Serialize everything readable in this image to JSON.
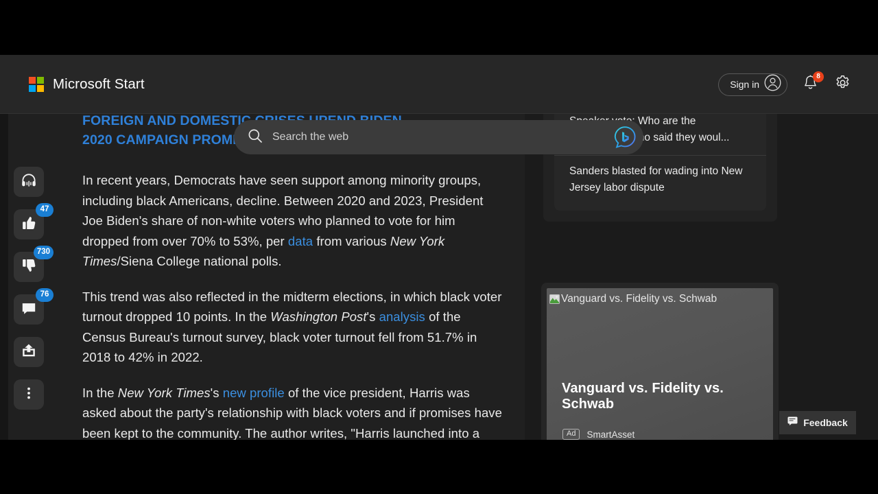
{
  "header": {
    "brand_name": "Microsoft Start",
    "logo_icon": "microsoft-logo-icon",
    "search": {
      "placeholder": "Search the web",
      "value": "",
      "search_icon": "search-icon",
      "chat_icon": "bing-chat-icon"
    },
    "sign_in_label": "Sign in",
    "account_icon": "account-person-icon",
    "notifications": {
      "icon": "bell-icon",
      "badge": "8",
      "badge_color": "#e8411a"
    },
    "settings_icon": "gear-icon"
  },
  "action_rail": [
    {
      "name": "listen",
      "icon": "headphones-icon",
      "badge": null
    },
    {
      "name": "like",
      "icon": "thumbs-up-icon",
      "badge": "47"
    },
    {
      "name": "dislike",
      "icon": "thumbs-down-icon",
      "badge": "730"
    },
    {
      "name": "comments",
      "icon": "comment-icon",
      "badge": "76"
    },
    {
      "name": "share",
      "icon": "share-icon",
      "badge": null
    },
    {
      "name": "more-options",
      "icon": "more-vertical-icon",
      "badge": null
    }
  ],
  "rail_badge_color": "#1a7fd4",
  "article": {
    "heading_line_1": "FOREIGN AND DOMESTIC CRISES UPEND BIDEN",
    "heading_line_2": "2020 CAMPAIGN PROMISE OF RETURN TO STABILITY",
    "link_color": "#2f80d8",
    "paragraphs": [
      {
        "segments": [
          {
            "type": "text",
            "text": "In recent years, Democrats have seen support among minority groups, including black Americans, decline. Between 2020 and 2023, President Joe Biden's share of non-white voters who planned to vote for him dropped from over 70% to 53%, per "
          },
          {
            "type": "link",
            "text": "data"
          },
          {
            "type": "text",
            "text": " from various "
          },
          {
            "type": "italic",
            "text": "New York Times"
          },
          {
            "type": "text",
            "text": "/Siena College national polls."
          }
        ]
      },
      {
        "segments": [
          {
            "type": "text",
            "text": "This trend was also reflected in the midterm elections, in which black voter turnout dropped 10 points. In the "
          },
          {
            "type": "italic",
            "text": "Washington Post"
          },
          {
            "type": "text",
            "text": "'s "
          },
          {
            "type": "link",
            "text": "analysis"
          },
          {
            "type": "text",
            "text": " of the Census Bureau's turnout survey, black voter turnout fell from 51.7% in 2018 to 42% in 2022."
          }
        ]
      },
      {
        "segments": [
          {
            "type": "text",
            "text": "In the "
          },
          {
            "type": "italic",
            "text": "New York Times"
          },
          {
            "type": "text",
            "text": "'s "
          },
          {
            "type": "link",
            "text": "new profile"
          },
          {
            "type": "text",
            "text": " of the vice president, Harris was asked about the party's relationship with black voters and if promises have been kept to the community. The author writes, \"Harris launched into a recitation of talking points.\""
          }
        ]
      }
    ]
  },
  "sidebar": {
    "news_items": [
      {
        "title": "Speaker vote: Who are the Republicans who said they woul..."
      },
      {
        "title": "Sanders blasted for wading into New Jersey labor dispute"
      }
    ],
    "ad": {
      "alt_text": "Vanguard vs. Fidelity vs. Schwab",
      "broken_image_icon": "broken-image-icon",
      "headline": "Vanguard vs. Fidelity vs. Schwab",
      "tag": "Ad",
      "advertiser": "SmartAsset"
    }
  },
  "feedback": {
    "label": "Feedback",
    "icon": "feedback-comment-icon"
  }
}
